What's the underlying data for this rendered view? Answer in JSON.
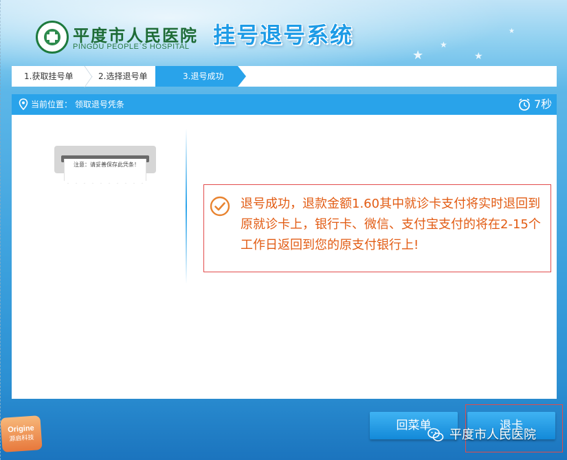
{
  "header": {
    "hospital_name": "平度市人民医院",
    "hospital_name_en": "PINGDU PEOPLE`S HOSPITAL",
    "system_title": "挂号退号系统"
  },
  "steps": [
    {
      "label": "1.获取挂号单",
      "active": false
    },
    {
      "label": "2.选择退号单",
      "active": false
    },
    {
      "label": "3.退号成功",
      "active": true
    }
  ],
  "location": {
    "label": "当前位置：",
    "page": "领取退号凭条",
    "timer": "7秒"
  },
  "receipt": {
    "note": "注意：请妥善保存此凭条！"
  },
  "message": {
    "text": "退号成功，退款金额1.60其中就诊卡支付将实时退回到原就诊卡上，银行卡、微信、支付宝支付的将在2-15个工作日返回到您的原支付银行上!"
  },
  "buttons": {
    "menu": "回菜单",
    "card": "退卡"
  },
  "watermark": {
    "text": "平度市人民医院"
  },
  "badge": {
    "line1": "Origine",
    "line2": "源启科技"
  },
  "colors": {
    "accent": "#29a3ea",
    "message_text": "#e25c14",
    "highlight_border": "#e24b4b",
    "logo_green": "#1d6b35"
  }
}
